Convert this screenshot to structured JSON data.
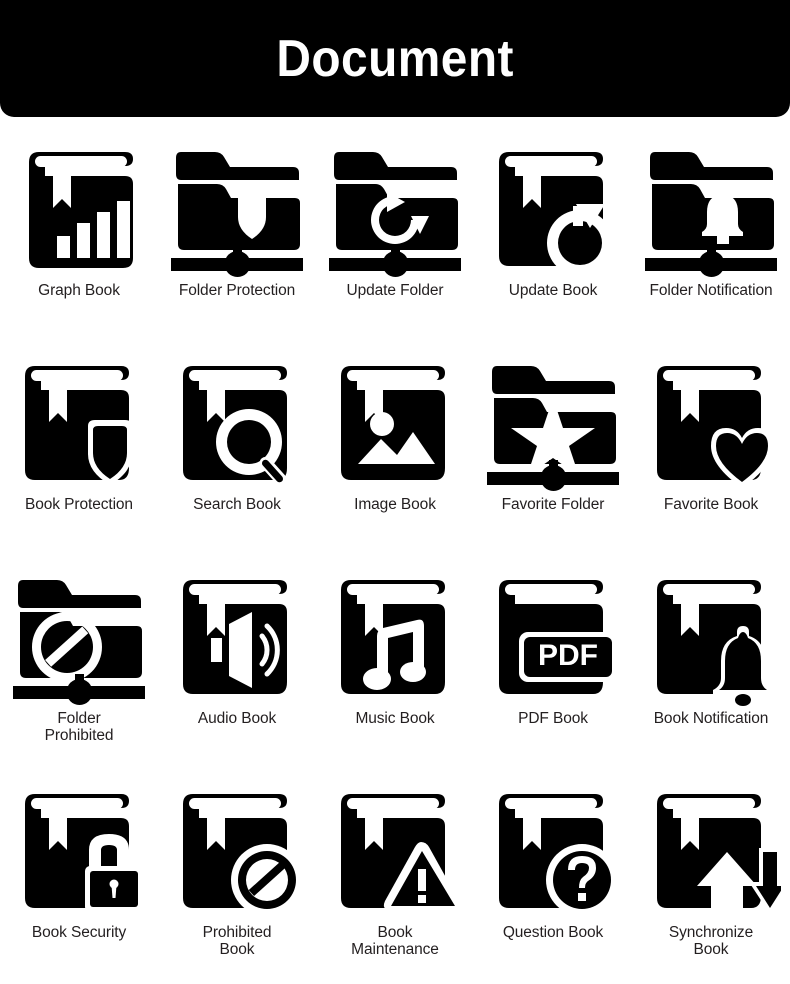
{
  "header": {
    "title": "Document",
    "background_color": "#000000",
    "text_color": "#ffffff"
  },
  "theme": {
    "page_background": "#ffffff",
    "icon_color": "#000000",
    "label_color": "#231f20"
  },
  "grid": {
    "columns": 5,
    "rows": 4,
    "total_icons": 20
  },
  "icons": [
    {
      "label": "Graph Book",
      "glyph": "graph-book-icon",
      "base": "book",
      "mark": "bar-chart"
    },
    {
      "label": "Folder Protection",
      "glyph": "folder-protection-icon",
      "base": "folder",
      "mark": "shield"
    },
    {
      "label": "Update Folder",
      "glyph": "update-folder-icon",
      "base": "folder",
      "mark": "refresh"
    },
    {
      "label": "Update Book",
      "glyph": "update-book-icon",
      "base": "book",
      "mark": "refresh-corner"
    },
    {
      "label": "Folder Notification",
      "glyph": "folder-notification-icon",
      "base": "folder",
      "mark": "bell"
    },
    {
      "label": "Book Protection",
      "glyph": "book-protection-icon",
      "base": "book",
      "mark": "shield-corner"
    },
    {
      "label": "Search Book",
      "glyph": "search-book-icon",
      "base": "book",
      "mark": "magnifier"
    },
    {
      "label": "Image Book",
      "glyph": "image-book-icon",
      "base": "book",
      "mark": "picture"
    },
    {
      "label": "Favorite Folder",
      "glyph": "favorite-folder-icon",
      "base": "folder",
      "mark": "star"
    },
    {
      "label": "Favorite Book",
      "glyph": "favorite-book-icon",
      "base": "book",
      "mark": "heart-corner"
    },
    {
      "label": "Folder\nProhibited",
      "glyph": "folder-prohibited-icon",
      "base": "folder",
      "mark": "prohibited"
    },
    {
      "label": "Audio Book",
      "glyph": "audio-book-icon",
      "base": "book",
      "mark": "speaker"
    },
    {
      "label": "Music Book",
      "glyph": "music-book-icon",
      "base": "book",
      "mark": "music-note"
    },
    {
      "label": "PDF Book",
      "glyph": "pdf-book-icon",
      "base": "book-plain",
      "mark": "pdf-badge",
      "badge_text": "PDF"
    },
    {
      "label": "Book Notification",
      "glyph": "book-notification-icon",
      "base": "book",
      "mark": "bell-corner"
    },
    {
      "label": "Book Security",
      "glyph": "book-security-icon",
      "base": "book",
      "mark": "padlock-corner"
    },
    {
      "label": "Prohibited\nBook",
      "glyph": "prohibited-book-icon",
      "base": "book",
      "mark": "prohibited-corner"
    },
    {
      "label": "Book\nMaintenance",
      "glyph": "book-maintenance-icon",
      "base": "book",
      "mark": "warning-corner"
    },
    {
      "label": "Question Book",
      "glyph": "question-book-icon",
      "base": "book",
      "mark": "question-corner"
    },
    {
      "label": "Synchronize\nBook",
      "glyph": "synchronize-book-icon",
      "base": "book",
      "mark": "sync-arrows"
    }
  ]
}
